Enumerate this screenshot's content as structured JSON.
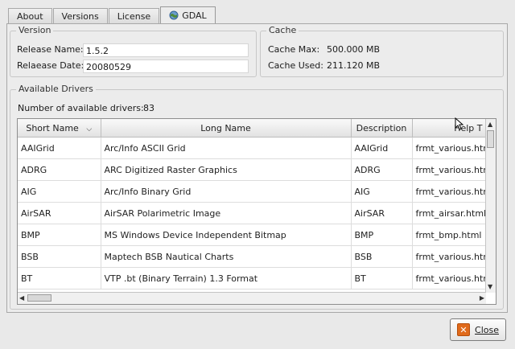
{
  "tabs": [
    "About",
    "Versions",
    "License",
    "GDAL"
  ],
  "version": {
    "title": "Version",
    "release_name_label": "Release Name:",
    "release_name": "1.5.2",
    "release_date_label": "Relaease Date:",
    "release_date": "20080529"
  },
  "cache": {
    "title": "Cache",
    "max_label": "Cache Max:",
    "max_value": "500.000 MB",
    "used_label": "Cache Used:",
    "used_value": "211.120 MB"
  },
  "drivers": {
    "title": "Available Drivers",
    "count_label": "Number of available drivers:",
    "count": "83",
    "columns": [
      "Short Name",
      "Long Name",
      "Description",
      "Help T"
    ],
    "rows": [
      [
        "AAIGrid",
        "Arc/Info ASCII Grid",
        "AAIGrid",
        "frmt_various.htm"
      ],
      [
        "ADRG",
        "ARC Digitized Raster Graphics",
        "ADRG",
        "frmt_various.htm"
      ],
      [
        "AIG",
        "Arc/Info Binary Grid",
        "AIG",
        "frmt_various.htm"
      ],
      [
        "AirSAR",
        "AirSAR Polarimetric Image",
        "AirSAR",
        "frmt_airsar.html"
      ],
      [
        "BMP",
        "MS Windows Device Independent Bitmap",
        "BMP",
        "frmt_bmp.html"
      ],
      [
        "BSB",
        "Maptech BSB Nautical Charts",
        "BSB",
        "frmt_various.htm"
      ],
      [
        "BT",
        "VTP .bt (Binary Terrain) 1.3 Format",
        "BT",
        "frmt_various.htm"
      ]
    ]
  },
  "close_label": "Close"
}
